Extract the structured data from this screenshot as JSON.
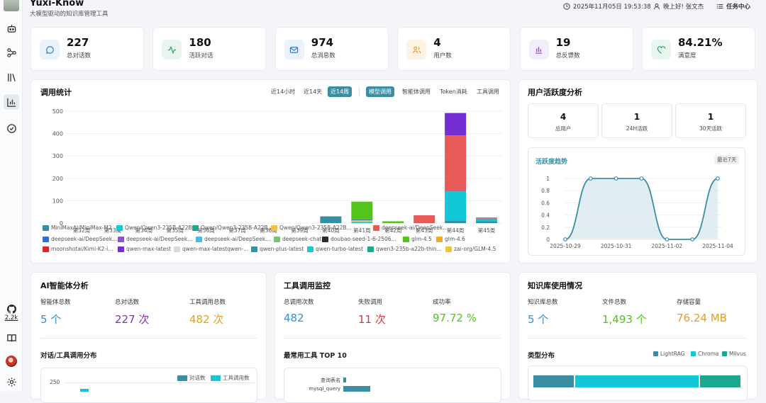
{
  "header": {
    "app_title": "Yuxi-Know",
    "app_subtitle": "大模型驱动的知识库管理工具",
    "datetime": "2025年11月05日 19:53:38",
    "greeting": "晚上好! 张文杰",
    "task_center": "任务中心"
  },
  "sidebar": {
    "github_count": "2.2k"
  },
  "stats": [
    {
      "value": "227",
      "label": "总对话数",
      "icon": "chat-icon",
      "color": "#2f7fd6",
      "bg": "#eaf2fb"
    },
    {
      "value": "180",
      "label": "活跃对话",
      "icon": "activity-icon",
      "color": "#2aa36b",
      "bg": "#e9f6ef"
    },
    {
      "value": "974",
      "label": "总消息数",
      "icon": "mail-icon",
      "color": "#2f7fd6",
      "bg": "#eaf2fb"
    },
    {
      "value": "4",
      "label": "用户数",
      "icon": "users-icon",
      "color": "#e29a2c",
      "bg": "#fdf3e4"
    },
    {
      "value": "19",
      "label": "总反馈数",
      "icon": "bar-icon",
      "color": "#8a56c9",
      "bg": "#f3ecfa"
    },
    {
      "value": "84.21%",
      "label": "满意度",
      "icon": "heart-icon",
      "color": "#2aa36b",
      "bg": "#e9f6ef"
    }
  ],
  "usage": {
    "title": "调用统计",
    "time_tabs": [
      "近14小时",
      "近14天",
      "近14周"
    ],
    "type_tabs": [
      "模型调用",
      "智能体调用",
      "Token消耗",
      "工具调用"
    ]
  },
  "chart_data": {
    "type": "bar",
    "stacked": true,
    "categories": [
      "第32周",
      "第33周",
      "第34周",
      "第35周",
      "第36周",
      "第37周",
      "第38周",
      "第39周",
      "第40周",
      "第41周",
      "第42周",
      "第43周",
      "第44周",
      "第45周"
    ],
    "ylim": [
      0,
      500
    ],
    "yticks": [
      0,
      100,
      200,
      300,
      400,
      500
    ],
    "series": [
      {
        "name": "MiniMaxAI/MiniMax-M2",
        "color": "#3a8ea3",
        "values": [
          0,
          0,
          0,
          0,
          0,
          0,
          0,
          0,
          30,
          0,
          0,
          0,
          12,
          8
        ]
      },
      {
        "name": "Qwen/Qwen3-235B-A22B...",
        "color": "#12c7d6",
        "values": [
          0,
          0,
          0,
          0,
          0,
          0,
          0,
          0,
          0,
          5,
          0,
          0,
          130,
          12
        ]
      },
      {
        "name": "Qwen/Qwen3-235B-A22B...",
        "color": "#1aa88f",
        "values": [
          0,
          0,
          0,
          0,
          0,
          0,
          0,
          0,
          0,
          0,
          0,
          0,
          0,
          0
        ]
      },
      {
        "name": "Qwen/Qwen3-235B-A22B...",
        "color": "#f2c242",
        "values": [
          0,
          0,
          0,
          0,
          0,
          0,
          0,
          0,
          0,
          8,
          0,
          0,
          0,
          0
        ]
      },
      {
        "name": "deepseek-ai/DeepSeek...",
        "color": "#e85a5a",
        "values": [
          0,
          0,
          0,
          0,
          0,
          0,
          0,
          0,
          0,
          0,
          0,
          35,
          250,
          5
        ]
      },
      {
        "name": "deepseek-ai/DeepSeek...",
        "color": "#2f6fd6",
        "values": [
          0,
          0,
          0,
          0,
          0,
          0,
          0,
          0,
          0,
          3,
          0,
          0,
          0,
          0
        ]
      },
      {
        "name": "deepseek-ai/DeepSeek...",
        "color": "#8a56c9",
        "values": [
          0,
          0,
          0,
          0,
          0,
          0,
          0,
          0,
          0,
          0,
          0,
          0,
          0,
          0
        ]
      },
      {
        "name": "deepseek-ai/DeepSeek...",
        "color": "#4db7e8",
        "values": [
          0,
          0,
          0,
          0,
          0,
          0,
          0,
          0,
          0,
          0,
          0,
          0,
          0,
          0
        ]
      },
      {
        "name": "deepseek-chat",
        "color": "#7ac27a",
        "values": [
          0,
          0,
          0,
          0,
          0,
          0,
          0,
          0,
          0,
          0,
          0,
          0,
          0,
          0
        ]
      },
      {
        "name": "doubao-seed-1-6-2506...",
        "color": "#2b2b2b",
        "values": [
          0,
          0,
          0,
          0,
          0,
          0,
          0,
          0,
          0,
          0,
          0,
          0,
          0,
          0
        ]
      },
      {
        "name": "glm-4.5",
        "color": "#52c41a",
        "values": [
          0,
          0,
          0,
          0,
          0,
          0,
          0,
          0,
          0,
          80,
          8,
          0,
          0,
          0
        ]
      },
      {
        "name": "glm-4.6",
        "color": "#f5a623",
        "values": [
          0,
          0,
          0,
          0,
          0,
          0,
          0,
          0,
          0,
          0,
          0,
          0,
          0,
          0
        ]
      },
      {
        "name": "moonshotai/Kimi-K2-i...",
        "color": "#e0222e",
        "values": [
          0,
          0,
          0,
          0,
          0,
          0,
          0,
          0,
          0,
          0,
          0,
          0,
          0,
          0
        ]
      },
      {
        "name": "qwen-max-latest",
        "color": "#722ed1",
        "values": [
          0,
          0,
          0,
          0,
          0,
          0,
          0,
          0,
          0,
          0,
          0,
          0,
          100,
          0
        ]
      },
      {
        "name": "qwen-max-latestqwen-...",
        "color": "#d9d9d9",
        "values": [
          0,
          0,
          0,
          0,
          0,
          0,
          0,
          0,
          0,
          0,
          0,
          0,
          0,
          0
        ]
      },
      {
        "name": "qwen-plus-latest",
        "color": "#3a8ea3",
        "values": [
          0,
          0,
          0,
          0,
          0,
          0,
          0,
          0,
          0,
          0,
          0,
          0,
          0,
          0
        ]
      },
      {
        "name": "qwen-turbo-latest",
        "color": "#12c7d6",
        "values": [
          0,
          0,
          0,
          0,
          0,
          0,
          0,
          0,
          0,
          0,
          0,
          0,
          0,
          0
        ]
      },
      {
        "name": "qwen3-235b-a22b-thin...",
        "color": "#1aa88f",
        "values": [
          0,
          0,
          0,
          0,
          0,
          0,
          0,
          0,
          0,
          0,
          0,
          0,
          0,
          0
        ]
      },
      {
        "name": "zai-org/GLM-4.5",
        "color": "#f2c242",
        "values": [
          0,
          0,
          0,
          0,
          0,
          0,
          0,
          0,
          0,
          0,
          0,
          0,
          0,
          0
        ]
      }
    ]
  },
  "activity": {
    "title": "用户活跃度分析",
    "cards": [
      {
        "value": "4",
        "label": "总用户"
      },
      {
        "value": "1",
        "label": "24H活跃"
      },
      {
        "value": "1",
        "label": "30天活跃"
      }
    ],
    "trend_title": "活跃度趋势",
    "trend_badge": "最近7天",
    "y_ticks": [
      "1",
      "0.8",
      "0.6",
      "0.4",
      "0.2",
      "0"
    ],
    "x_ticks": [
      "2025-10-29",
      "2025-10-31",
      "2025-11-02",
      "2025-11-04"
    ],
    "series": [
      0,
      1,
      1,
      1,
      0,
      0,
      1
    ]
  },
  "agent": {
    "title": "AI智能体分析",
    "metrics": [
      {
        "label": "智能体总数",
        "value": "5 个",
        "color": "#2f8fd8"
      },
      {
        "label": "总对话数",
        "value": "227 次",
        "color": "#8a2fc0"
      },
      {
        "label": "工具调用总数",
        "value": "482 次",
        "color": "#e3a21a"
      }
    ],
    "dist_title": "对话/工具调用分布",
    "legend": [
      "对话数",
      "工具调用数"
    ],
    "y_tick": "250"
  },
  "tools": {
    "title": "工具调用监控",
    "metrics": [
      {
        "label": "总调用次数",
        "value": "482",
        "color": "#2f8fd8"
      },
      {
        "label": "失败调用",
        "value": "11 次",
        "color": "#d13a3a"
      },
      {
        "label": "成功率",
        "value": "97.72 %",
        "color": "#52c41a"
      }
    ],
    "top_title": "最常用工具 TOP 10",
    "top_items": [
      "查询表名",
      "mysql_query"
    ]
  },
  "kb": {
    "title": "知识库使用情况",
    "metrics": [
      {
        "label": "知识库总数",
        "value": "5 个",
        "color": "#2f8fd8"
      },
      {
        "label": "文件总数",
        "value": "1,493 个",
        "color": "#52c41a"
      },
      {
        "label": "存储容量",
        "value": "76.24 MB",
        "color": "#e3a21a"
      }
    ],
    "type_title": "类型分布",
    "type_legend": [
      "LightRAG",
      "Chroma",
      "Milvus"
    ]
  }
}
